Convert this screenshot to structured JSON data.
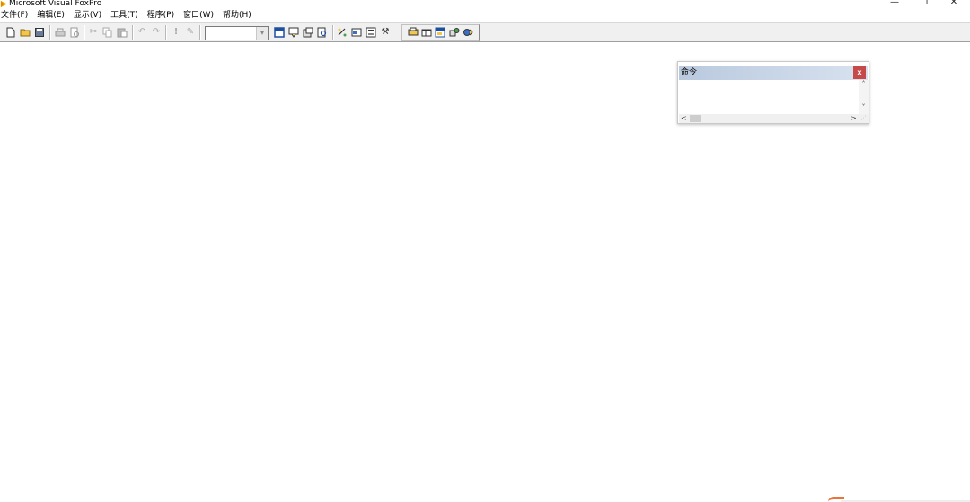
{
  "window": {
    "title": "Microsoft Visual FoxPro",
    "controls": {
      "minimize": "—",
      "restore": "❐",
      "close": "✕"
    }
  },
  "menubar": [
    {
      "label": "文件(F)",
      "name": "menu-file"
    },
    {
      "label": "编辑(E)",
      "name": "menu-edit"
    },
    {
      "label": "显示(V)",
      "name": "menu-view"
    },
    {
      "label": "工具(T)",
      "name": "menu-tools"
    },
    {
      "label": "程序(P)",
      "name": "menu-program"
    },
    {
      "label": "窗口(W)",
      "name": "menu-window"
    },
    {
      "label": "帮助(H)",
      "name": "menu-help"
    }
  ],
  "toolbar": {
    "combo_value": "",
    "combo_arrow": "▾",
    "glyphs": {
      "cut": "✂",
      "undo": "↶",
      "redo": "↷",
      "run": "!",
      "modify": "✎",
      "tools": "⚒"
    },
    "icons": [
      "new-file-icon",
      "open-folder-icon",
      "save-icon",
      "print-icon",
      "print-preview-icon",
      "cut-icon",
      "copy-icon",
      "paste-icon",
      "undo-icon",
      "redo-icon",
      "run-icon",
      "modify-form-icon",
      "command-window-icon",
      "view-window-icon",
      "data-session-icon",
      "code-references-icon",
      "form-wizard-icon",
      "report-wizard-icon",
      "autoform-icon",
      "toolbox-icon",
      "database-icon",
      "table-icon",
      "query-icon",
      "connection-icon",
      "refresh-icon"
    ]
  },
  "command_window": {
    "title": "命令",
    "close_label": "x",
    "content": "",
    "scroll_up": "˄",
    "scroll_down": "˅",
    "scroll_left": "<",
    "scroll_right": ">",
    "grip": "⋰"
  },
  "colors": {
    "toolbar_bg": "#f0f0f0",
    "cmd_title_gradient_start": "#b9c9de",
    "cmd_title_gradient_end": "#d8e2ef",
    "cmd_close_bg": "#c74a4a",
    "app_icon": "#f5b400",
    "accent_orange": "#e8743b"
  }
}
